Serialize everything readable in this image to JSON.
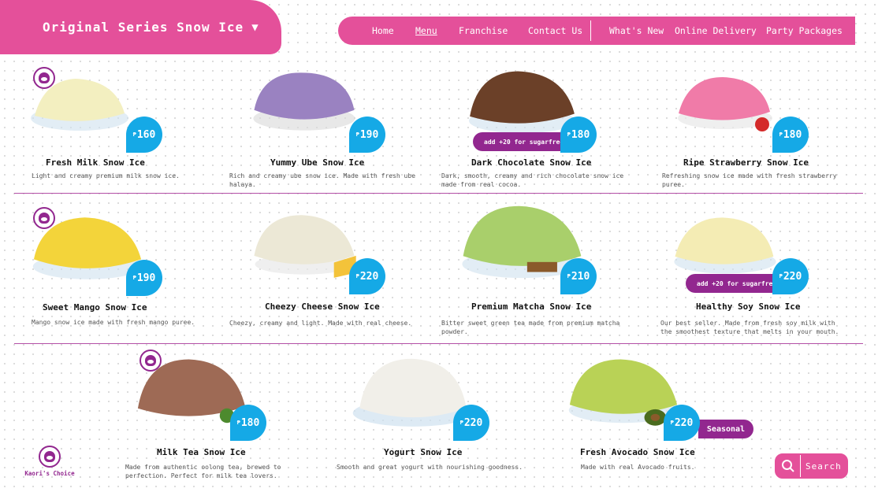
{
  "header": {
    "title": "Original Series Snow Ice",
    "title_chevron": "▼"
  },
  "nav": {
    "items": [
      {
        "label": "Home"
      },
      {
        "label": "Menu",
        "active": true
      },
      {
        "label": "Franchise"
      },
      {
        "label": "Contact Us"
      },
      {
        "label": "What's New"
      },
      {
        "label": "Online Delivery"
      },
      {
        "label": "Party Packages"
      }
    ]
  },
  "currency": "₱",
  "products": [
    {
      "name": "Fresh Milk Snow Ice",
      "price": "160",
      "desc": "Light and creamy premium milk snow ice.",
      "color": "#f3efc0"
    },
    {
      "name": "Yummy Ube Snow Ice",
      "price": "190",
      "desc": "Rich and creamy ube snow ice. Made with fresh ube halaya.",
      "color": "#9a82c1"
    },
    {
      "name": "Dark Chocolate Snow Ice",
      "price": "180",
      "desc": "Dark, smooth, creamy and rich chocolate snow ice made from real cocoa.",
      "color": "#6b4028",
      "sugarfree": "add +20 for sugarfree"
    },
    {
      "name": "Ripe Strawberry Snow Ice",
      "price": "180",
      "desc": "Refreshing snow ice made with fresh strawberry puree.",
      "color": "#f07ba8"
    },
    {
      "name": "Sweet Mango Snow Ice",
      "price": "190",
      "desc": "Mango snow ice made with fresh mango puree.",
      "color": "#f3d43a"
    },
    {
      "name": "Cheezy Cheese Snow Ice",
      "price": "220",
      "desc": "Cheezy, creamy and light. Made with real cheese.",
      "color": "#ece8d6"
    },
    {
      "name": "Premium Matcha Snow Ice",
      "price": "210",
      "desc": "Bitter sweet green tea made from premium matcha powder.",
      "color": "#a9cf6b"
    },
    {
      "name": "Healthy Soy Snow Ice",
      "price": "220",
      "desc": "Our best seller. Made from fresh soy milk with the smoothest texture that melts in your mouth.",
      "color": "#f4ecb4",
      "sugarfree": "add +20 for sugarfree"
    },
    {
      "name": "Milk Tea Snow Ice",
      "price": "180",
      "desc": "Made from authentic oolong tea, brewed to perfection. Perfect for milk tea lovers.",
      "color": "#9e6a55"
    },
    {
      "name": "Yogurt Snow Ice",
      "price": "220",
      "desc": "Smooth and great yogurt with nourishing goodness.",
      "color": "#f1efe9"
    },
    {
      "name": "Fresh Avocado Snow Ice",
      "price": "220",
      "desc": "Made with real Avocado fruits.",
      "color": "#b9d256",
      "badge": "Seasonal"
    }
  ],
  "kaori": {
    "label": "Kaori's Choice"
  },
  "search": {
    "label": "Search"
  },
  "colors": {
    "brand_pink": "#e4509a",
    "purple": "#92278f",
    "price_blue": "#15a9e6"
  }
}
